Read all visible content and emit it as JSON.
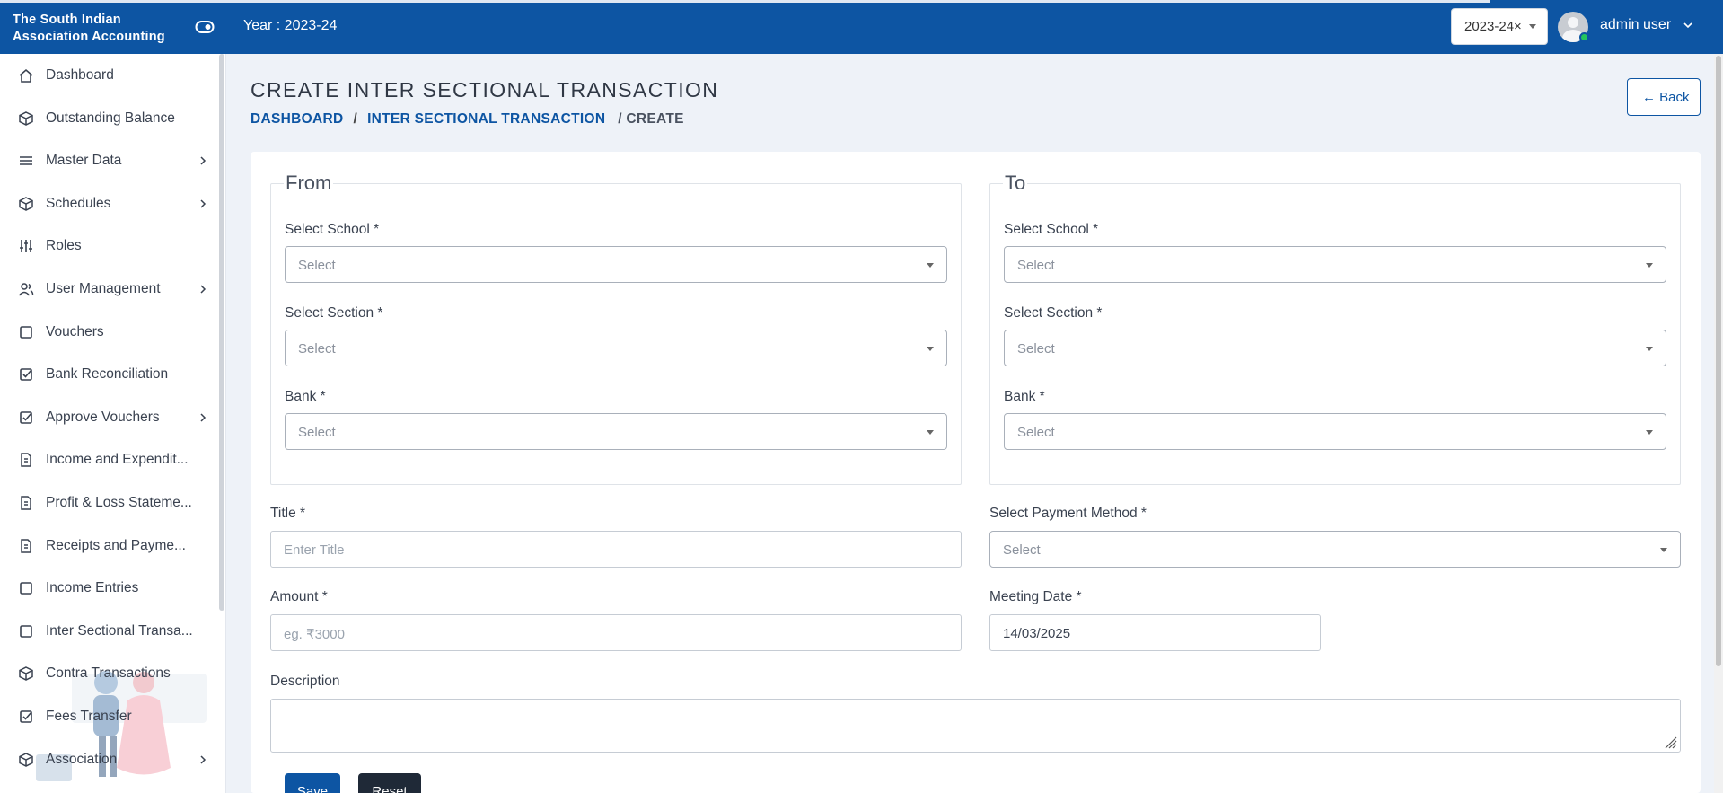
{
  "app": {
    "title": "The South Indian Association Accounting",
    "year_label": "Year : 2023-24",
    "year_select_value": "2023-24×",
    "user_name": "admin user"
  },
  "sidebar": {
    "items": [
      {
        "label": "Dashboard",
        "icon": "home-icon",
        "has_submenu": false
      },
      {
        "label": "Outstanding Balance",
        "icon": "cube-icon",
        "has_submenu": false
      },
      {
        "label": "Master Data",
        "icon": "list-icon",
        "has_submenu": true
      },
      {
        "label": "Schedules",
        "icon": "cube-icon",
        "has_submenu": true
      },
      {
        "label": "Roles",
        "icon": "sliders-icon",
        "has_submenu": false
      },
      {
        "label": "User Management",
        "icon": "users-icon",
        "has_submenu": true
      },
      {
        "label": "Vouchers",
        "icon": "square-icon",
        "has_submenu": false
      },
      {
        "label": "Bank Reconciliation",
        "icon": "checkbox-icon",
        "has_submenu": false
      },
      {
        "label": "Approve Vouchers",
        "icon": "checkbox-icon",
        "has_submenu": true
      },
      {
        "label": "Income and Expendit...",
        "icon": "document-icon",
        "has_submenu": false
      },
      {
        "label": "Profit & Loss Stateme...",
        "icon": "document-icon",
        "has_submenu": false
      },
      {
        "label": "Receipts and Payme...",
        "icon": "document-icon",
        "has_submenu": false
      },
      {
        "label": "Income Entries",
        "icon": "square-icon",
        "has_submenu": false
      },
      {
        "label": "Inter Sectional Transa...",
        "icon": "square-icon",
        "has_submenu": false
      },
      {
        "label": "Contra Transactions",
        "icon": "cube-icon",
        "has_submenu": false
      },
      {
        "label": "Fees Transfer",
        "icon": "checkbox-icon",
        "has_submenu": false
      },
      {
        "label": "Association",
        "icon": "cube-icon",
        "has_submenu": true
      }
    ]
  },
  "header": {
    "title": "CREATE INTER SECTIONAL TRANSACTION",
    "breadcrumb": {
      "home": "DASHBOARD",
      "section": "INTER SECTIONAL TRANSACTION",
      "current": "/ CREATE",
      "separator": "/"
    },
    "back_label": "← Back"
  },
  "form": {
    "from": {
      "legend": "From",
      "school_label": "Select School *",
      "school_value": "Select",
      "section_label": "Select Section *",
      "section_value": "Select",
      "bank_label": "Bank *",
      "bank_value": "Select"
    },
    "to": {
      "legend": "To",
      "school_label": "Select School *",
      "school_value": "Select",
      "section_label": "Select Section *",
      "section_value": "Select",
      "bank_label": "Bank *",
      "bank_value": "Select"
    },
    "title_label": "Title *",
    "title_placeholder": "Enter Title",
    "payment_label": "Select Payment Method *",
    "payment_value": "Select",
    "amount_label": "Amount *",
    "amount_placeholder": "eg. ₹3000",
    "meeting_date_label": "Meeting Date *",
    "meeting_date_value": "14/03/2025",
    "description_label": "Description",
    "save_label": "Save",
    "reset_label": "Reset"
  },
  "colors": {
    "primary": "#0d55a3",
    "dark_button": "#1f2937",
    "online": "#22c55e"
  }
}
